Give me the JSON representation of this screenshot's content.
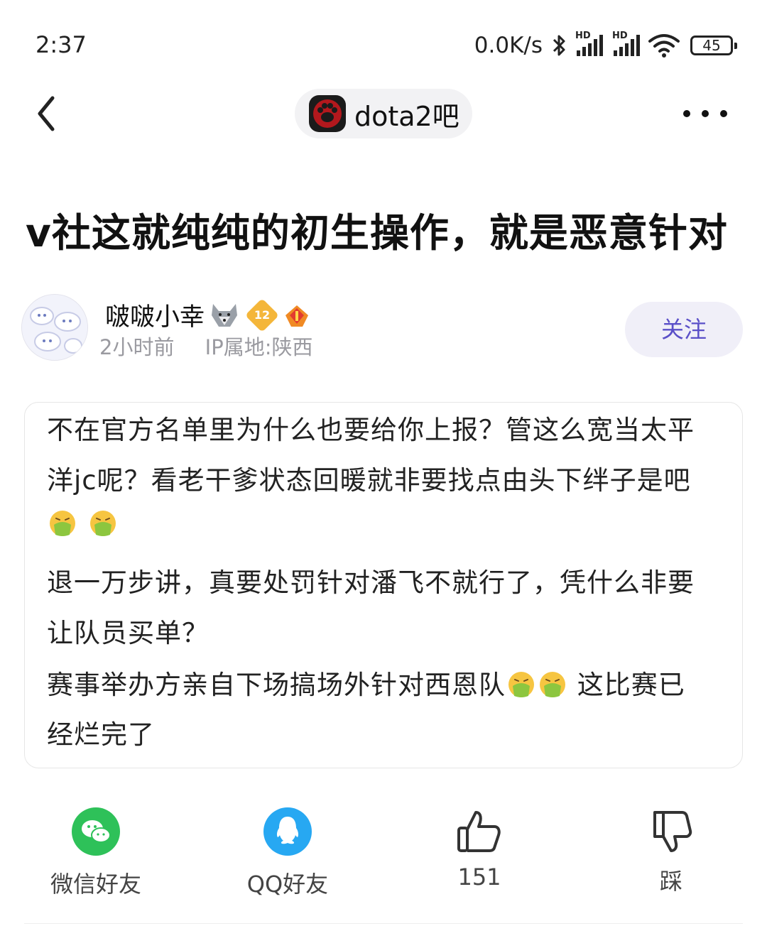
{
  "status_bar": {
    "time": "2:37",
    "net_speed": "0.0K/s",
    "battery": "45",
    "hd_label": "HD"
  },
  "header": {
    "forum_name": "dota2吧"
  },
  "post": {
    "title": "v社这就纯纯的初生操作，就是恶意针对",
    "author": {
      "name": "啵啵小幸",
      "level": "12",
      "time": "2小时前",
      "ip": "IP属地:陕西"
    },
    "follow_label": "关注",
    "content_lines": [
      "不在官方名单里为什么也要给你上报？管这么宽当太平",
      "洋jc呢？看老干爹状态回暖就非要找点由头下绊子是吧",
      "退一万步讲，真要处罚针对潘飞不就行了，凭什么非要",
      "让队员买单？",
      " 赛事举办方亲自下场搞场外针对西恩队",
      " 这比赛已",
      "经烂完了"
    ]
  },
  "actions": {
    "wechat_label": "微信好友",
    "qq_label": "QQ好友",
    "like_count": "151",
    "dislike_label": "踩"
  },
  "colors": {
    "accent": "#5a4fc8",
    "wechat_green": "#2ec159",
    "qq_blue": "#27a8f2",
    "emoji_yellow": "#f6c541",
    "emoji_green": "#8cc63f"
  }
}
